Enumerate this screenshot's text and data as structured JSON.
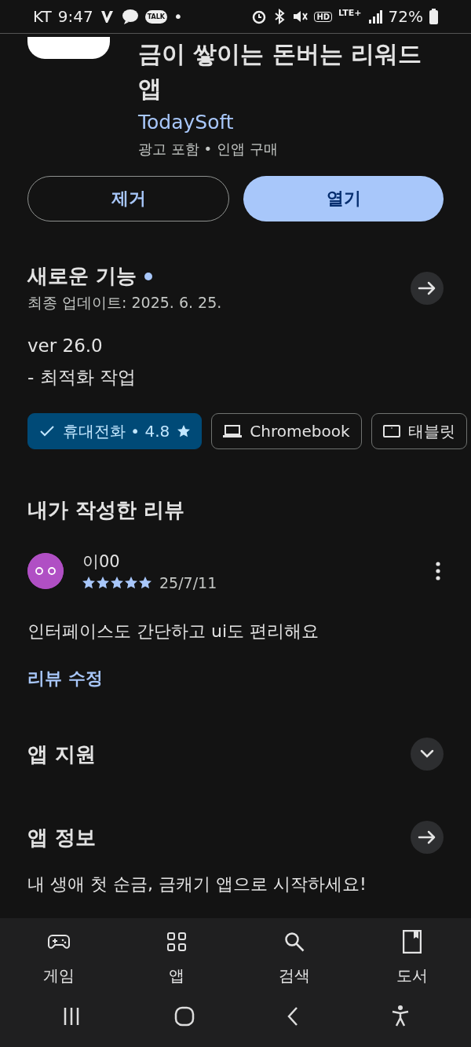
{
  "status_bar": {
    "carrier": "KT",
    "time": "9:47",
    "talk": "TALK",
    "notification_dot": "•",
    "hd": "HD",
    "network": "LTE+",
    "battery": "72%"
  },
  "app": {
    "title": "금이 쌓이는 돈버는 리워드 앱",
    "developer": "TodaySoft",
    "meta": "광고 포함 • 인앱 구매"
  },
  "buttons": [
    {
      "label": "제거",
      "kind": "outlined"
    },
    {
      "label": "열기",
      "kind": "filled"
    }
  ],
  "whats_new": {
    "title": "새로운 기능",
    "new_dot": true,
    "updated": "최종 업데이트: 2025. 6. 25.",
    "version": "ver 26.0",
    "notes": "- 최적화 작업"
  },
  "devices": [
    {
      "label": "휴대전화 • 4.8",
      "kind": "phone",
      "selected": true,
      "star": true
    },
    {
      "label": "Chromebook",
      "kind": "laptop",
      "selected": false,
      "star": false
    },
    {
      "label": "태블릿",
      "kind": "tablet",
      "selected": false,
      "star": false
    }
  ],
  "my_review": {
    "title": "내가 작성한 리뷰",
    "reviewer": "이00",
    "stars": 5,
    "date": "25/7/11",
    "text": "인터페이스도 간단하고 ui도 편리해요",
    "edit_link": "리뷰 수정"
  },
  "sections": [
    {
      "title": "앱 지원",
      "kind": "expand"
    },
    {
      "title": "앱 정보",
      "kind": "arrow",
      "description": "내 생애 첫 순금, 금캐기 앱으로 시작하세요!"
    }
  ],
  "bottom_nav": [
    {
      "label": "게임",
      "kind": "games",
      "selected": false
    },
    {
      "label": "앱",
      "kind": "apps",
      "selected": false
    },
    {
      "label": "검색",
      "kind": "search",
      "selected": false
    },
    {
      "label": "도서",
      "kind": "books",
      "selected": false
    }
  ]
}
